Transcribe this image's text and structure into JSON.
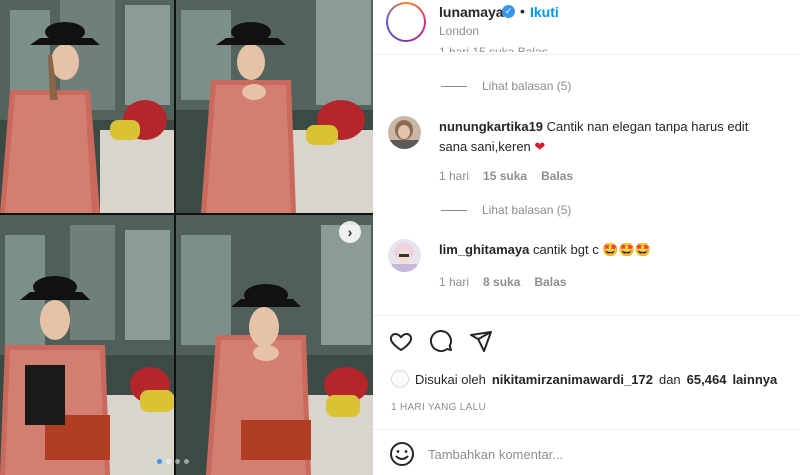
{
  "header": {
    "username": "lunamaya",
    "separator": "•",
    "follow_label": "Ikuti",
    "location": "London"
  },
  "partial_comment_meta": "1 hari    15 suka    Balas",
  "comments": [
    {
      "replies_label": "Lihat balasan (5)"
    },
    {
      "username": "nunungkartika19",
      "text": "Cantik nan elegan tanpa harus edit sana sani,keren",
      "emoji": "heart",
      "time": "1 hari",
      "likes": "15 suka",
      "reply_label": "Balas",
      "replies_label": "Lihat balasan (5)"
    },
    {
      "username": "lim_ghitamaya",
      "text": "cantik bgt c",
      "emoji": "star-struck x3",
      "time": "1 hari",
      "likes": "8 suka",
      "reply_label": "Balas"
    }
  ],
  "actions": {
    "like_icon": "heart-icon",
    "comment_icon": "comment-icon",
    "share_icon": "share-icon"
  },
  "likes": {
    "prefix": "Disukai oleh",
    "user": "nikitamirzanimawardi_172",
    "middle": "dan",
    "count": "65,464",
    "suffix": "lainnya"
  },
  "date": "1 HARI YANG LALU",
  "add_comment": {
    "placeholder": "Tambahkan komentar..."
  },
  "carousel": {
    "total_dots": 4,
    "active_index": 0
  },
  "colors": {
    "link_blue": "#0095f6",
    "verified_blue": "#3897f0",
    "meta_grey": "#8e8e8e",
    "heart_red": "#ed4956"
  }
}
